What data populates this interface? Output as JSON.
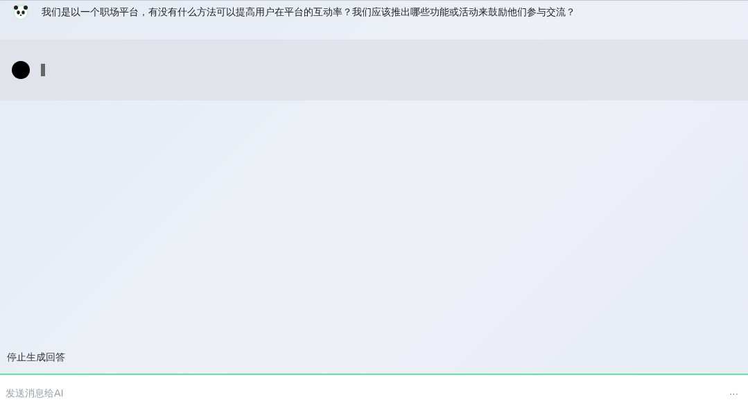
{
  "messages": [
    {
      "kind": "user",
      "text": "我们是以一个职场平台，有没有什么方法可以提高用户在平台的互动率？我们应该推出哪些功能或活动来鼓励他们参与交流？"
    },
    {
      "kind": "assistant"
    }
  ],
  "stop_button": {
    "label": "停止生成回答"
  },
  "composer": {
    "placeholder": "发送消息给AI",
    "more": "···"
  }
}
